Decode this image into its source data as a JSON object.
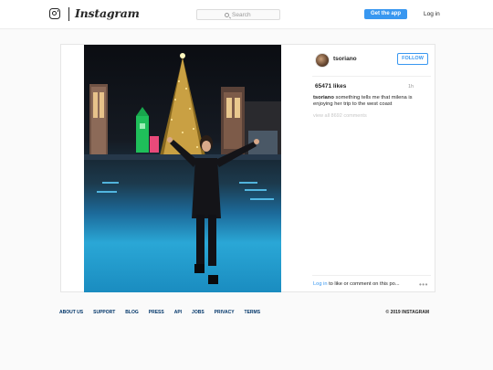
{
  "header": {
    "logo_icon": "instagram-glyph-icon",
    "wordmark": "Instagram",
    "search_placeholder": "Search",
    "get_app_label": "Get the app",
    "login_label": "Log in"
  },
  "post": {
    "username": "tsoriano",
    "follow_label": "FOLLOW",
    "likes": "65471 likes",
    "time_ago": "1h",
    "caption_user": "tsoriano",
    "caption_text": " something tells me that milena is enjoying her trip to the west coast",
    "view_comments": "view all 8692 comments",
    "login_link": "Log in",
    "login_rest": " to like or comment on this po...",
    "more_options": "•••"
  },
  "footer": {
    "links": [
      "ABOUT US",
      "SUPPORT",
      "BLOG",
      "PRESS",
      "API",
      "JOBS",
      "PRIVACY",
      "TERMS"
    ],
    "copyright": "© 2019 INSTAGRAM"
  },
  "colors": {
    "accent": "#3897f0",
    "footer_link": "#003569",
    "background": "#fafafa"
  }
}
